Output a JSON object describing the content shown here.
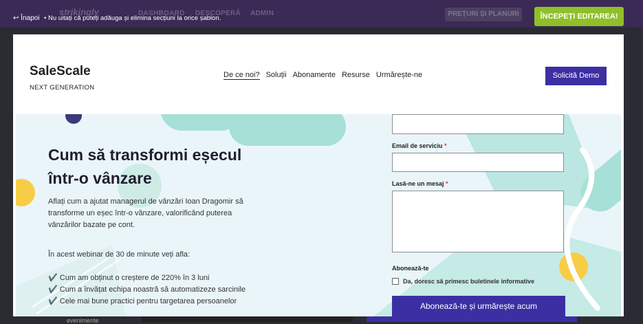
{
  "topbar": {
    "brand_ghost": "strikingly",
    "nav_ghost": [
      "DASHBOARD",
      "DESCOPERĂ",
      "ADMIN"
    ],
    "back_label": "Înapoi",
    "tip": "•  Nu uitați că puteți adăuga și elimina secțiuni la orice șablon.",
    "pricing_label": "PREȚURI ȘI PLANURI",
    "start_label": "ÎNCEPEȚI EDITAREA!"
  },
  "site": {
    "logo": "SaleScale",
    "tagline": "NEXT GENERATION",
    "nav": [
      "De ce noi?",
      "Soluții",
      "Abonamente",
      "Resurse",
      "Urmărește-ne"
    ],
    "demo_label": "Solicită Demo"
  },
  "hero": {
    "title": "Cum să transformi eșecul într-o vânzare",
    "description": "Aflați cum a ajutat managerul de vânzări Ioan Dragomir să transforme un eșec într-o vânzare, valorificând puterea vânzărilor bazate pe cont.",
    "intro": "În acest webinar de 30 de minute veți afla:",
    "bullets": [
      "✔️ Cum am obținut o creștere de 220% în 3 luni",
      "✔️ Cum a învățat echipa noastră să automatizeze sarcinile",
      "✔️ Cele mai bune practici pentru targetarea persoanelor"
    ]
  },
  "form": {
    "email_label": "Email de serviciu",
    "message_label": "Lasă-ne un mesaj",
    "required_mark": "*",
    "subscribe_label": "Abonează-te",
    "subscribe_check": "Da, doresc să primesc buletinele informative",
    "submit_label": "Abonează-te și urmărește acum"
  },
  "below": {
    "partial_word": "evenimente"
  },
  "colors": {
    "topbar": "#3a2a55",
    "accent_purple": "#3b2fa3",
    "green": "#8fc028",
    "mint": "#a7e0d6",
    "yellow": "#f7cd45",
    "hero_bg": "#eaf5fa"
  }
}
